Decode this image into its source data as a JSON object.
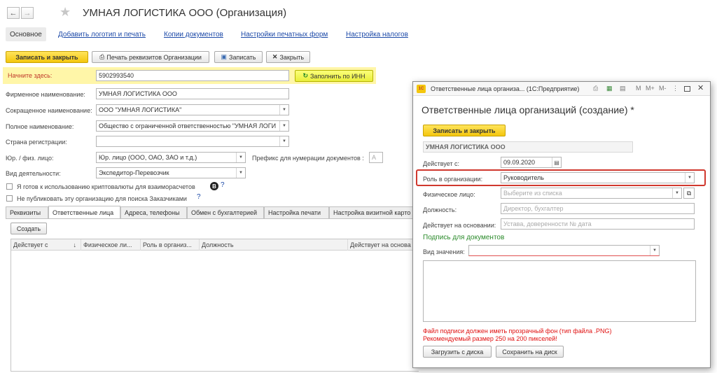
{
  "window": {
    "title": "УМНАЯ ЛОГИСТИКА ООО (Организация)"
  },
  "nav_links": [
    "Основное",
    "Добавить логотип и печать",
    "Копии документов",
    "Настройки печатных форм",
    "Настройка налогов"
  ],
  "toolbar": {
    "save_close": "Записать и закрыть",
    "print": "Печать реквизитов Организации",
    "save": "Записать",
    "close": "Закрыть"
  },
  "start": {
    "label": "Начните здесь:",
    "inn": "5902993540",
    "fill_button": "Заполнить по ИНН"
  },
  "form": {
    "firm_name_label": "Фирменное наименование:",
    "firm_name": "УМНАЯ ЛОГИСТИКА ООО",
    "short_name_label": "Сокращенное наименование:",
    "short_name": "ООО \"УМНАЯ ЛОГИСТИКА\"",
    "full_name_label": "Полное наименование:",
    "full_name": "Общество с ограниченной ответственностью \"УМНАЯ ЛОГИ",
    "country_label": "Страна регистрации:",
    "country": "",
    "entity_label": "Юр. / физ. лицо:",
    "entity": "Юр. лицо (ООО, ОАО, ЗАО и т.д.)",
    "prefix_label": "Префикс для нумерации документов :",
    "prefix": "А",
    "activity_label": "Вид деятельности:",
    "activity": "Экспедитор-Перевозчик",
    "crypto_label": "Я готов к использованию криптовалюты для взаиморасчетов",
    "crypto_badge": "B",
    "publish_label": "Не публиковать эту организацию для поиска Заказчиками",
    "help": "?"
  },
  "tabs": [
    "Реквизиты",
    "Ответственные лица",
    "Адреса, телефоны",
    "Обмен с бухгалтерией",
    "Настройка печати",
    "Настройка визитной карто"
  ],
  "tabs_active": 1,
  "table": {
    "create_button": "Создать",
    "columns": [
      "Действует с",
      "Физическое ли...",
      "Роль в организ...",
      "Должность",
      "Действует на основа"
    ],
    "sort_arrow": "↓"
  },
  "dialog": {
    "app_badge": "1С",
    "title_bar": "Ответственные лица организа...   (1С:Предприятие)",
    "tb_icons": [
      "M",
      "M+",
      "M-"
    ],
    "heading": "Ответственные лица организаций (создание) *",
    "save_close": "Записать и закрыть",
    "org": "УМНАЯ ЛОГИСТИКА ООО",
    "valid_from_label": "Действует с:",
    "valid_from": "09.09.2020",
    "role_label": "Роль в организации:",
    "role": "Руководитель",
    "person_label": "Физическое лицо:",
    "person_placeholder": "Выберите из списка",
    "position_label": "Должность:",
    "position_placeholder": "Директор, бухгалтер",
    "basis_label": "Действует на основании:",
    "basis_placeholder": "Устава, доверенности № дата",
    "signature_heading": "Подпись для документов",
    "value_kind_label": "Вид значения:",
    "value_kind": "",
    "warning_line1": "Файл подписи должен иметь прозрачный фон (тип файла .PNG)",
    "warning_line2": "Рекомендуемый размер 250 на 200 пикселей!",
    "load_button": "Загрузить с диска",
    "save_disk_button": "Сохранить на диск"
  },
  "colors": {
    "yellow_button": "#f4c60d",
    "highlight": "#fff6a8",
    "link": "#1d4aa8",
    "green_heading": "#2a8a2a",
    "warning": "#e01010",
    "role_frame": "#d0382e"
  }
}
